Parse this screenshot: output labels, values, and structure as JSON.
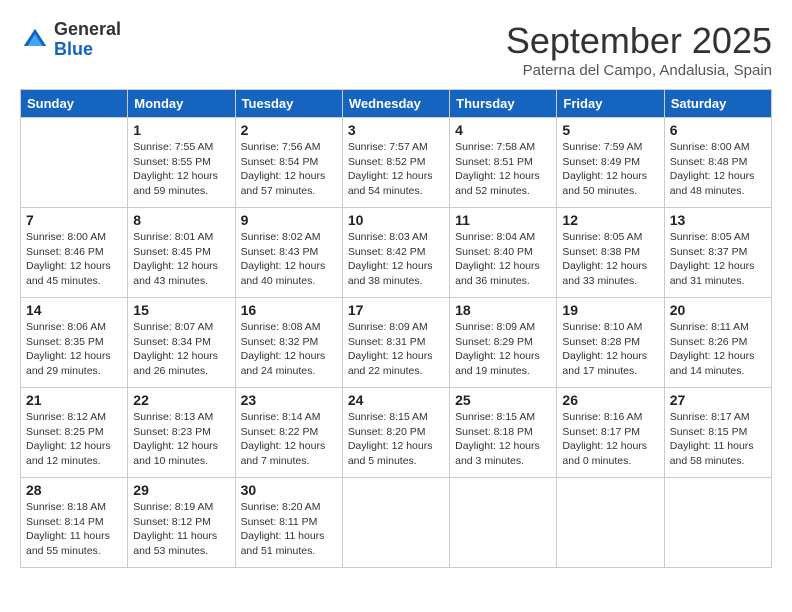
{
  "header": {
    "logo_line1": "General",
    "logo_line2": "Blue",
    "month_title": "September 2025",
    "subtitle": "Paterna del Campo, Andalusia, Spain"
  },
  "days_of_week": [
    "Sunday",
    "Monday",
    "Tuesday",
    "Wednesday",
    "Thursday",
    "Friday",
    "Saturday"
  ],
  "weeks": [
    [
      {
        "day": "",
        "info": ""
      },
      {
        "day": "1",
        "info": "Sunrise: 7:55 AM\nSunset: 8:55 PM\nDaylight: 12 hours\nand 59 minutes."
      },
      {
        "day": "2",
        "info": "Sunrise: 7:56 AM\nSunset: 8:54 PM\nDaylight: 12 hours\nand 57 minutes."
      },
      {
        "day": "3",
        "info": "Sunrise: 7:57 AM\nSunset: 8:52 PM\nDaylight: 12 hours\nand 54 minutes."
      },
      {
        "day": "4",
        "info": "Sunrise: 7:58 AM\nSunset: 8:51 PM\nDaylight: 12 hours\nand 52 minutes."
      },
      {
        "day": "5",
        "info": "Sunrise: 7:59 AM\nSunset: 8:49 PM\nDaylight: 12 hours\nand 50 minutes."
      },
      {
        "day": "6",
        "info": "Sunrise: 8:00 AM\nSunset: 8:48 PM\nDaylight: 12 hours\nand 48 minutes."
      }
    ],
    [
      {
        "day": "7",
        "info": "Sunrise: 8:00 AM\nSunset: 8:46 PM\nDaylight: 12 hours\nand 45 minutes."
      },
      {
        "day": "8",
        "info": "Sunrise: 8:01 AM\nSunset: 8:45 PM\nDaylight: 12 hours\nand 43 minutes."
      },
      {
        "day": "9",
        "info": "Sunrise: 8:02 AM\nSunset: 8:43 PM\nDaylight: 12 hours\nand 40 minutes."
      },
      {
        "day": "10",
        "info": "Sunrise: 8:03 AM\nSunset: 8:42 PM\nDaylight: 12 hours\nand 38 minutes."
      },
      {
        "day": "11",
        "info": "Sunrise: 8:04 AM\nSunset: 8:40 PM\nDaylight: 12 hours\nand 36 minutes."
      },
      {
        "day": "12",
        "info": "Sunrise: 8:05 AM\nSunset: 8:38 PM\nDaylight: 12 hours\nand 33 minutes."
      },
      {
        "day": "13",
        "info": "Sunrise: 8:05 AM\nSunset: 8:37 PM\nDaylight: 12 hours\nand 31 minutes."
      }
    ],
    [
      {
        "day": "14",
        "info": "Sunrise: 8:06 AM\nSunset: 8:35 PM\nDaylight: 12 hours\nand 29 minutes."
      },
      {
        "day": "15",
        "info": "Sunrise: 8:07 AM\nSunset: 8:34 PM\nDaylight: 12 hours\nand 26 minutes."
      },
      {
        "day": "16",
        "info": "Sunrise: 8:08 AM\nSunset: 8:32 PM\nDaylight: 12 hours\nand 24 minutes."
      },
      {
        "day": "17",
        "info": "Sunrise: 8:09 AM\nSunset: 8:31 PM\nDaylight: 12 hours\nand 22 minutes."
      },
      {
        "day": "18",
        "info": "Sunrise: 8:09 AM\nSunset: 8:29 PM\nDaylight: 12 hours\nand 19 minutes."
      },
      {
        "day": "19",
        "info": "Sunrise: 8:10 AM\nSunset: 8:28 PM\nDaylight: 12 hours\nand 17 minutes."
      },
      {
        "day": "20",
        "info": "Sunrise: 8:11 AM\nSunset: 8:26 PM\nDaylight: 12 hours\nand 14 minutes."
      }
    ],
    [
      {
        "day": "21",
        "info": "Sunrise: 8:12 AM\nSunset: 8:25 PM\nDaylight: 12 hours\nand 12 minutes."
      },
      {
        "day": "22",
        "info": "Sunrise: 8:13 AM\nSunset: 8:23 PM\nDaylight: 12 hours\nand 10 minutes."
      },
      {
        "day": "23",
        "info": "Sunrise: 8:14 AM\nSunset: 8:22 PM\nDaylight: 12 hours\nand 7 minutes."
      },
      {
        "day": "24",
        "info": "Sunrise: 8:15 AM\nSunset: 8:20 PM\nDaylight: 12 hours\nand 5 minutes."
      },
      {
        "day": "25",
        "info": "Sunrise: 8:15 AM\nSunset: 8:18 PM\nDaylight: 12 hours\nand 3 minutes."
      },
      {
        "day": "26",
        "info": "Sunrise: 8:16 AM\nSunset: 8:17 PM\nDaylight: 12 hours\nand 0 minutes."
      },
      {
        "day": "27",
        "info": "Sunrise: 8:17 AM\nSunset: 8:15 PM\nDaylight: 11 hours\nand 58 minutes."
      }
    ],
    [
      {
        "day": "28",
        "info": "Sunrise: 8:18 AM\nSunset: 8:14 PM\nDaylight: 11 hours\nand 55 minutes."
      },
      {
        "day": "29",
        "info": "Sunrise: 8:19 AM\nSunset: 8:12 PM\nDaylight: 11 hours\nand 53 minutes."
      },
      {
        "day": "30",
        "info": "Sunrise: 8:20 AM\nSunset: 8:11 PM\nDaylight: 11 hours\nand 51 minutes."
      },
      {
        "day": "",
        "info": ""
      },
      {
        "day": "",
        "info": ""
      },
      {
        "day": "",
        "info": ""
      },
      {
        "day": "",
        "info": ""
      }
    ]
  ]
}
